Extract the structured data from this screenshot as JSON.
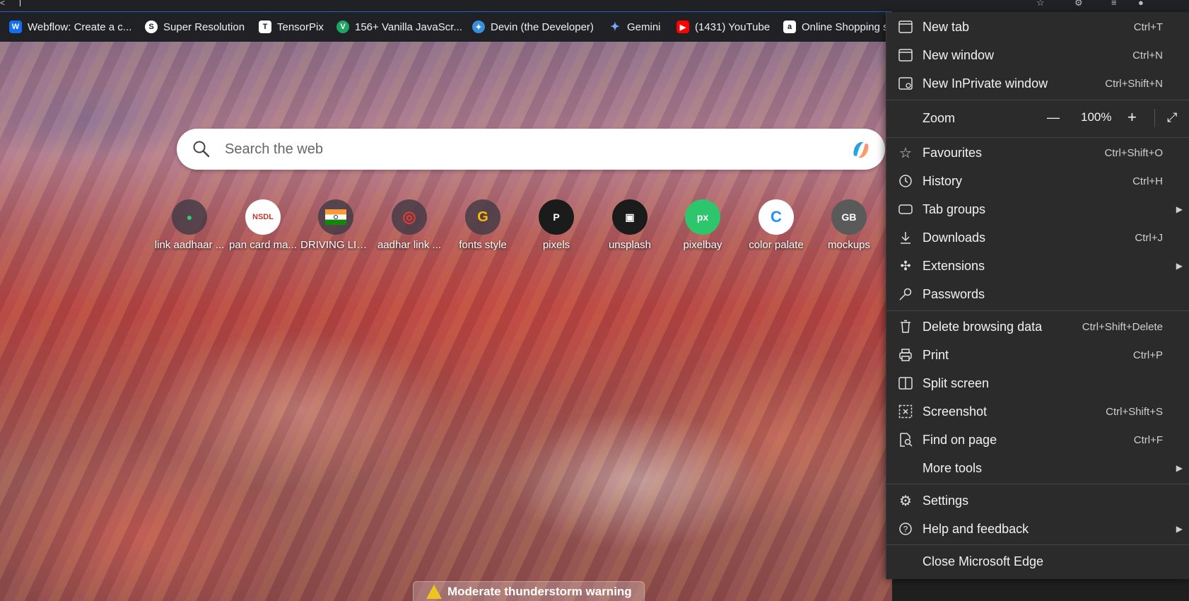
{
  "favorites": [
    {
      "label": "Webflow: Create a c...",
      "icon": "webflow-icon",
      "color": "#146ef5"
    },
    {
      "label": "Super Resolution",
      "icon": "super-resolution-icon",
      "color": "#202124"
    },
    {
      "label": "TensorPix",
      "icon": "tensorpix-icon",
      "color": "#ffffff"
    },
    {
      "label": "156+ Vanilla JavaScr...",
      "icon": "vanilla-js-icon",
      "color": "#1fa463"
    },
    {
      "label": "Devin (the Developer)",
      "icon": "devin-icon",
      "color": "#3a8fd8"
    },
    {
      "label": "Gemini",
      "icon": "gemini-icon",
      "color": "#5b8def"
    },
    {
      "label": "(1431) YouTube",
      "icon": "youtube-icon",
      "color": "#ff0000"
    },
    {
      "label": "Online Shopping s",
      "icon": "amazon-icon",
      "color": "#ffffff"
    }
  ],
  "search": {
    "placeholder": "Search the web"
  },
  "quick_links": [
    {
      "label": "link aadhaar ...",
      "glyph": "●",
      "color": "#3c3c3c",
      "icon": "aadhaar-link-icon"
    },
    {
      "label": "pan card ma...",
      "glyph": "NSDL",
      "color": "#ffffff",
      "icon": "nsdl-icon"
    },
    {
      "label": "DRIVING LIC...",
      "glyph": "▮",
      "color": "#ff9933",
      "icon": "india-flag-icon"
    },
    {
      "label": "aadhar link ...",
      "glyph": "◎",
      "color": "#c21f2f",
      "icon": "aadhaar-fingerprint-icon"
    },
    {
      "label": "fonts style",
      "glyph": "G",
      "color": "#4285f4",
      "icon": "google-fonts-icon"
    },
    {
      "label": "pixels",
      "glyph": "P",
      "color": "#1b1b1b",
      "icon": "pexels-icon"
    },
    {
      "label": "unsplash",
      "glyph": "▣",
      "color": "#1b1b1b",
      "icon": "unsplash-icon"
    },
    {
      "label": "pixelbay",
      "glyph": "px",
      "color": "#2ec66d",
      "icon": "pixabay-icon"
    },
    {
      "label": "color palate",
      "glyph": "C",
      "color": "#1e90ff",
      "icon": "color-palette-icon"
    },
    {
      "label": "mockups",
      "glyph": "GB",
      "color": "#555555",
      "icon": "mockups-icon"
    }
  ],
  "weather": {
    "text": "Moderate thunderstorm warning"
  },
  "menu": {
    "new_tab": {
      "label": "New tab",
      "shortcut": "Ctrl+T"
    },
    "new_window": {
      "label": "New window",
      "shortcut": "Ctrl+N"
    },
    "new_inprivate": {
      "label": "New InPrivate window",
      "shortcut": "Ctrl+Shift+N"
    },
    "zoom": {
      "label": "Zoom",
      "value": "100%"
    },
    "favourites": {
      "label": "Favourites",
      "shortcut": "Ctrl+Shift+O"
    },
    "history": {
      "label": "History",
      "shortcut": "Ctrl+H"
    },
    "tab_groups": {
      "label": "Tab groups"
    },
    "downloads": {
      "label": "Downloads",
      "shortcut": "Ctrl+J"
    },
    "extensions": {
      "label": "Extensions"
    },
    "passwords": {
      "label": "Passwords"
    },
    "delete_browsing": {
      "label": "Delete browsing data",
      "shortcut": "Ctrl+Shift+Delete"
    },
    "print": {
      "label": "Print",
      "shortcut": "Ctrl+P"
    },
    "split_screen": {
      "label": "Split screen"
    },
    "screenshot": {
      "label": "Screenshot",
      "shortcut": "Ctrl+Shift+S"
    },
    "find_on_page": {
      "label": "Find on page",
      "shortcut": "Ctrl+F"
    },
    "more_tools": {
      "label": "More tools"
    },
    "settings": {
      "label": "Settings"
    },
    "help": {
      "label": "Help and feedback"
    },
    "close": {
      "label": "Close Microsoft Edge"
    }
  }
}
